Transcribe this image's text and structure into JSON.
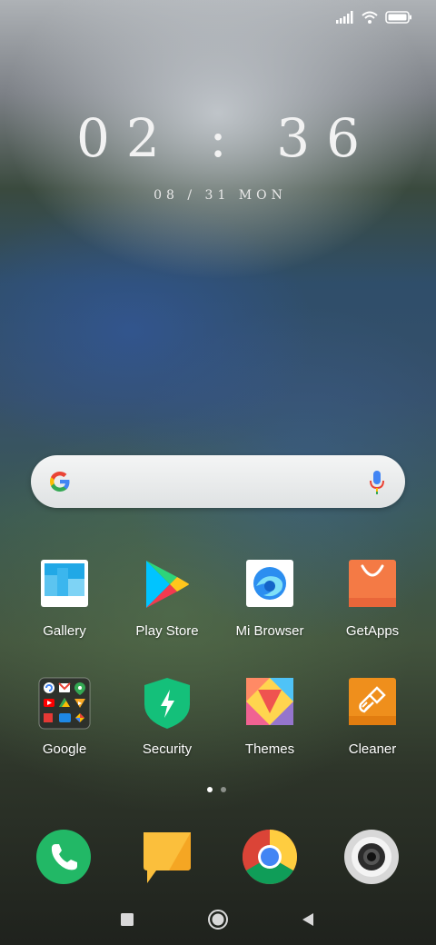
{
  "clock": {
    "time": "02 : 36",
    "date": "08 / 31  MON"
  },
  "status_bar": {
    "icons": [
      "signal-icon",
      "wifi-icon",
      "battery-icon"
    ]
  },
  "search_bar": {
    "icons": [
      "google-g-icon",
      "microphone-icon"
    ]
  },
  "apps": {
    "row1": [
      {
        "label": "Gallery",
        "icon": "gallery-icon"
      },
      {
        "label": "Play Store",
        "icon": "play-store-icon"
      },
      {
        "label": "Mi Browser",
        "icon": "mi-browser-icon"
      },
      {
        "label": "GetApps",
        "icon": "getapps-icon"
      }
    ],
    "row2": [
      {
        "label": "Google",
        "icon": "google-folder-icon"
      },
      {
        "label": "Security",
        "icon": "security-icon"
      },
      {
        "label": "Themes",
        "icon": "themes-icon"
      },
      {
        "label": "Cleaner",
        "icon": "cleaner-icon"
      }
    ]
  },
  "page_indicator": {
    "pages": 2,
    "active": 1
  },
  "dock": [
    "phone-icon",
    "messages-icon",
    "chrome-icon",
    "camera-icon"
  ],
  "nav": [
    "recents-button",
    "home-button",
    "back-button"
  ],
  "colors": {
    "phone_green": "#22b866",
    "security_green": "#14c07a",
    "getapps_orange": "#f47a45",
    "cleaner_orange": "#ef8f1c",
    "messages_yellow": "#fbbf3c"
  }
}
